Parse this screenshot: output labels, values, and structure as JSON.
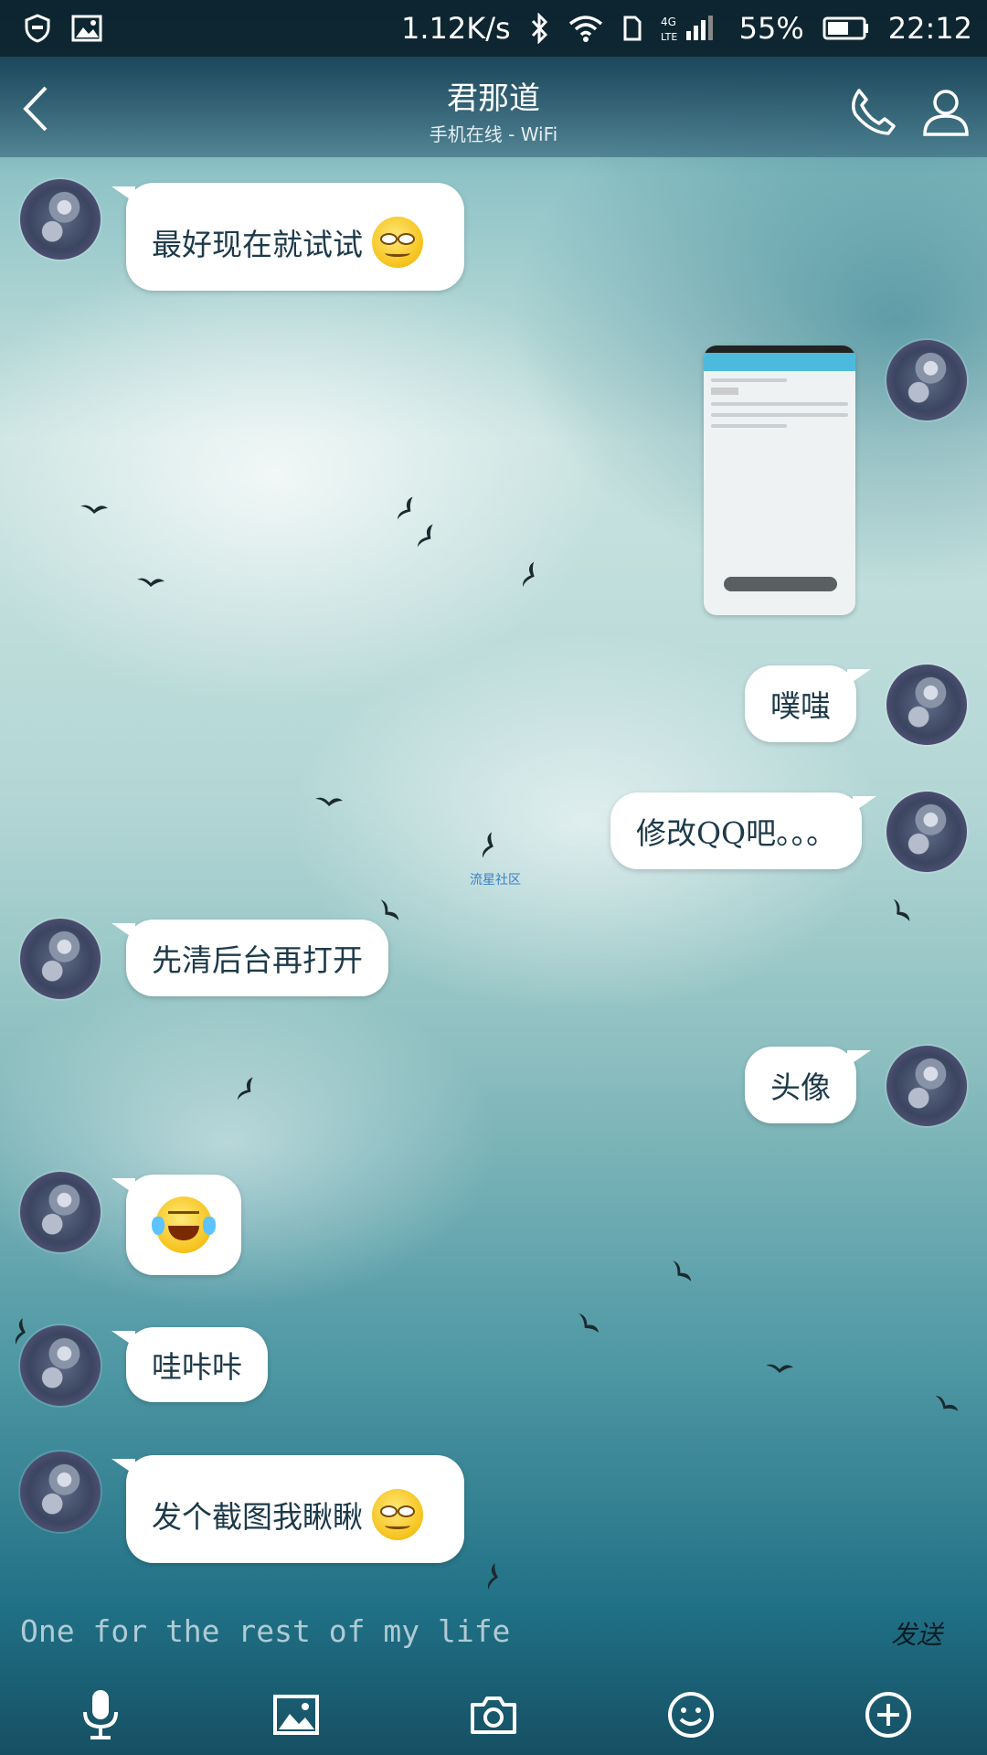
{
  "status_bar": {
    "net_speed": "1.12K/s",
    "network_type": "4G LTE",
    "battery": "55%",
    "time": "22:12",
    "icons": [
      "shield-icon",
      "image-icon",
      "bluetooth-icon",
      "wifi-icon",
      "sim-icon",
      "signal-icon",
      "battery-icon"
    ]
  },
  "header": {
    "title": "君那道",
    "subtitle": "手机在线 - WiFi",
    "back_icon": "chevron-left-icon",
    "call_icon": "phone-icon",
    "profile_icon": "person-icon"
  },
  "messages": [
    {
      "side": "left",
      "text": "最好现在就试试",
      "emoji": "smirk"
    },
    {
      "side": "right",
      "type": "image",
      "text": ""
    },
    {
      "side": "right",
      "text": "噗嗤"
    },
    {
      "side": "right",
      "text": "修改QQ吧。。。"
    },
    {
      "side": "left",
      "text": "先清后台再打开"
    },
    {
      "side": "right",
      "text": "头像"
    },
    {
      "side": "left",
      "text": "",
      "emoji": "laugh"
    },
    {
      "side": "left",
      "text": "哇咔咔"
    },
    {
      "side": "left",
      "text": "发个截图我瞅瞅",
      "emoji": "smirk"
    }
  ],
  "watermark": "流星社区",
  "input": {
    "value": "One for the rest of my life",
    "send_label": "发送"
  },
  "toolbar": {
    "icons": [
      "microphone-icon",
      "image-icon",
      "camera-icon",
      "emoji-icon",
      "plus-icon"
    ]
  },
  "colors": {
    "bubble": "#ffffff",
    "bubble_text": "#1d3a4a",
    "status_bar": "#0a1e28"
  }
}
